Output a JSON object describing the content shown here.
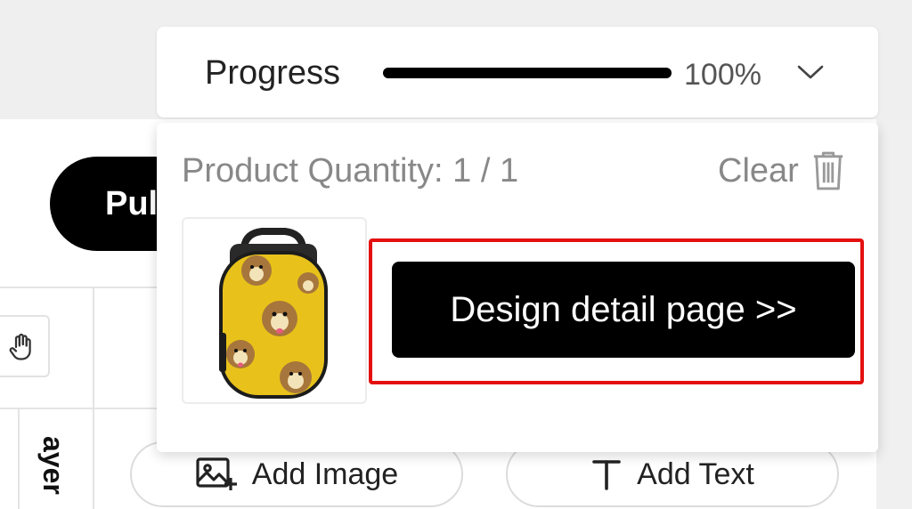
{
  "progress": {
    "label": "Progress",
    "percent_text": "100%",
    "value": 1.0,
    "fill_color": "#000000",
    "toggle_icon": "chevron-down-icon"
  },
  "panel": {
    "quantity_label": "Product Quantity: 1 / 1",
    "clear_label": "Clear",
    "clear_icon": "trash-icon",
    "product_image_alt": "yellow-dog-backpack",
    "design_button_label": "Design detail page >>",
    "highlight_color": "#e3100f"
  },
  "background": {
    "publish_button_label": "Pul",
    "layer_tab_label": "ayer",
    "hand_tool_icon": "hand-icon",
    "add_image_label": "Add Image",
    "add_image_icon": "image-add-icon",
    "add_text_label": "Add Text",
    "add_text_icon": "text-icon"
  }
}
